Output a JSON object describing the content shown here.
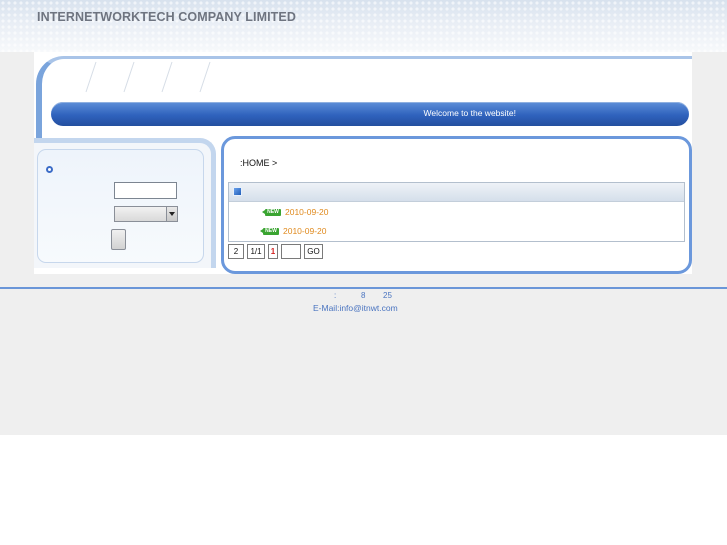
{
  "header": {
    "company_name": "INTERNETWORKTECH COMPANY LIMITED"
  },
  "banner": {
    "welcome_text": "Welcome to the website!"
  },
  "sidebar": {
    "search_input_value": "",
    "select_value": "",
    "submit_label": ""
  },
  "content": {
    "breadcrumb": ":HOME >",
    "list_items": [
      {
        "badge": "NEW",
        "date": "2010-09-20"
      },
      {
        "badge": "NEW",
        "date": "2010-09-20"
      }
    ],
    "pager": {
      "total": "2",
      "page_of": "1/1",
      "current_page": "1",
      "jump_value": "",
      "go_label": "GO"
    }
  },
  "footer": {
    "colon": ":",
    "num_a": "8",
    "num_b": "25",
    "email_line": "E-Mail:info@itnwt.com"
  },
  "colors": {
    "accent_blue": "#2f62bd",
    "frame_blue": "#6b98dc",
    "date_orange": "#e08a1e",
    "badge_green": "#3aa431"
  }
}
